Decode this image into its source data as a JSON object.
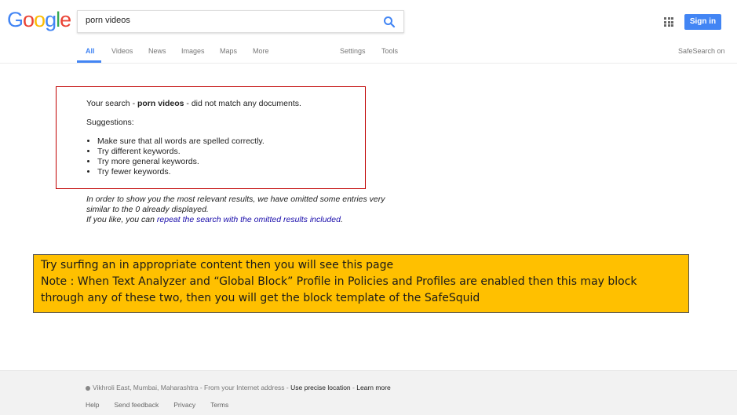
{
  "logo": {
    "letters": [
      "G",
      "o",
      "o",
      "g",
      "l",
      "e"
    ],
    "colors": [
      "#4285f4",
      "#ea4335",
      "#fbbc05",
      "#4285f4",
      "#34a853",
      "#ea4335"
    ]
  },
  "search": {
    "value": "porn videos",
    "icon": "search-icon",
    "icon_color": "#4285f4"
  },
  "header": {
    "signin_label": "Sign in",
    "apps_icon": "apps-grid-icon"
  },
  "nav": {
    "tabs": [
      "All",
      "Videos",
      "News",
      "Images",
      "Maps",
      "More"
    ],
    "active": "All",
    "settings": "Settings",
    "tools": "Tools",
    "safesearch": "SafeSearch on"
  },
  "result": {
    "prefix": "Your search - ",
    "query": "porn videos",
    "suffix": " - did not match any documents.",
    "suggestions_title": "Suggestions:",
    "suggestions": [
      "Make sure that all words are spelled correctly.",
      "Try different keywords.",
      "Try more general keywords.",
      "Try fewer keywords."
    ],
    "border_color": "#c00000"
  },
  "omitted": {
    "line1": "In order to show you the most relevant results, we have omitted some entries very",
    "line2": "similar to the 0 already displayed.",
    "line3_prefix": "If you like, you can ",
    "line3_link": "repeat the search with the omitted results included",
    "line3_suffix": "."
  },
  "note": {
    "line1": "Try surfing an in appropriate content then you will see this page",
    "line2": "Note : When Text Analyzer and “Global Block” Profile in Policies and Profiles are enabled then this may block",
    "line3": "through any of these two, then you will get the block template of the SafeSquid",
    "bg_color": "#ffc000"
  },
  "footer": {
    "location": "Vikhroli East, Mumbai, Maharashtra",
    "from_ip": " - From your Internet address - ",
    "precise_link": "Use precise location",
    "sep": " - ",
    "learn_link": "Learn more",
    "links": [
      "Help",
      "Send feedback",
      "Privacy",
      "Terms"
    ]
  }
}
